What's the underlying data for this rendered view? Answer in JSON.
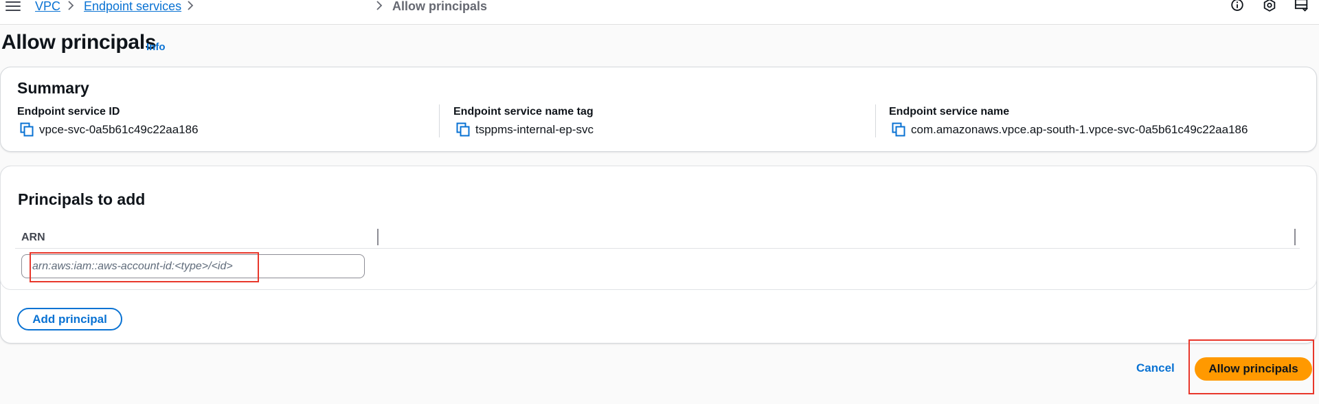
{
  "breadcrumbs": [
    {
      "label": "VPC"
    },
    {
      "label": "Endpoint services"
    },
    {
      "label": "Allow principals"
    }
  ],
  "page": {
    "title": "Allow principals",
    "info_link": "Info"
  },
  "summary": {
    "heading": "Summary",
    "fields": [
      {
        "label": "Endpoint service ID",
        "value": "vpce-svc-0a5b61c49c22aa186"
      },
      {
        "label": "Endpoint service name tag",
        "value": "tsppms-internal-ep-svc"
      },
      {
        "label": "Endpoint service name",
        "value": "com.amazonaws.vpce.ap-south-1.vpce-svc-0a5b61c49c22aa186"
      }
    ]
  },
  "principals": {
    "heading": "Principals to add",
    "column_header": "ARN",
    "arn_input": {
      "value": "",
      "placeholder": "arn:aws:iam::aws-account-id:<type>/<id>"
    },
    "add_button": "Add principal"
  },
  "footer": {
    "cancel_label": "Cancel",
    "submit_label": "Allow principals"
  },
  "icons": {
    "menu": "hamburger-menu-icon",
    "chevron": "chevron-right-icon",
    "info": "info-circle-icon",
    "settings": "hexagon-settings-icon",
    "split_panel": "split-panel-icon",
    "copy": "copy-icon"
  },
  "colors": {
    "link": "#0972d3",
    "primary_button": "#ff9900",
    "annotation": "#e8362a"
  }
}
